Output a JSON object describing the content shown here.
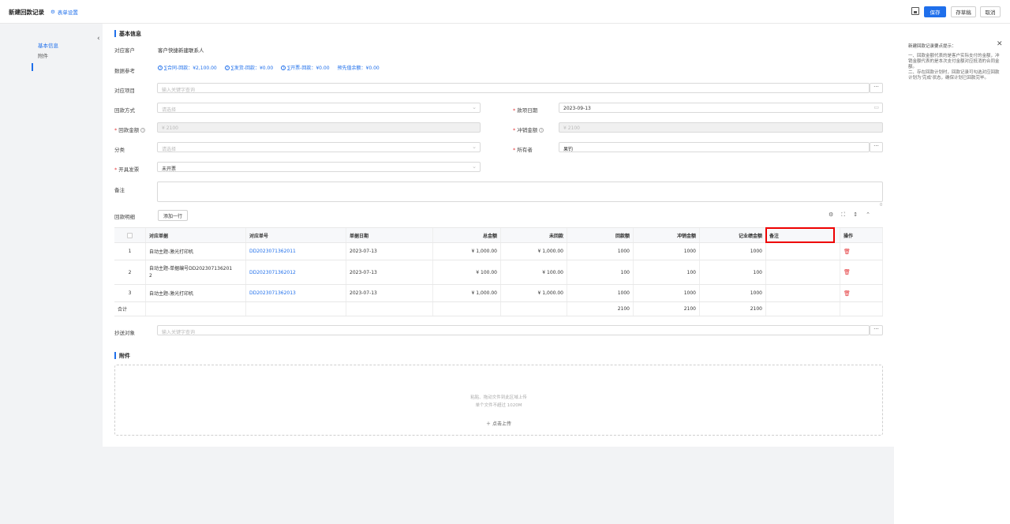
{
  "header": {
    "title": "新建回款记录",
    "form_settings": "表单设置",
    "save": "保存",
    "save_draft": "存草稿",
    "cancel": "取消"
  },
  "nav": {
    "items": [
      "基本信息",
      "附件"
    ]
  },
  "tips": {
    "title": "新建回款记录要点提示：",
    "body": "一、回款金额代表的是客户实际支付的金额，冲销金额代表的是本次支付金额对应抵消的合同金额。\n二、存在回款计划时，回款记录可勾选对应回款计划为'完成'状态，确保计划已回款完毕。"
  },
  "basic": {
    "section_title": "基本信息",
    "customer_label": "对应客户",
    "customer_value": "客户快捷新建联系人",
    "ref_label": "数据参考",
    "refs": [
      "∑合同-回款：¥2,100.00",
      "∑发货-回款：¥0.00",
      "∑开票-回款：¥0.00",
      "预先值余额：¥0.00"
    ],
    "project_label": "对应项目",
    "project_placeholder": "输入关键字查询",
    "method_label": "回款方式",
    "method_placeholder": "请选择",
    "date_label": "款项日期",
    "date_value": "2023-09-13",
    "amount_label": "回款金额",
    "amount_value": "¥ 2100",
    "offset_label": "冲销金额",
    "offset_value": "¥ 2100",
    "category_label": "分类",
    "category_placeholder": "请选择",
    "owner_label": "所有者",
    "owner_value": "果钓",
    "invoice_label": "开具发票",
    "invoice_value": "未开票",
    "remark_label": "备注",
    "remark_count": "0"
  },
  "detail": {
    "label": "回款明细",
    "add_row": "添加一行",
    "columns": [
      "对应单据",
      "对应单号",
      "单据日期",
      "总金额",
      "未回款",
      "回款额",
      "冲销金额",
      "记业绩金额",
      "备注",
      "操作"
    ],
    "rows": [
      {
        "no": "1",
        "doc": "自动主题-激光打印机",
        "code": "DD2023071362011",
        "date": "2023-07-13",
        "total": "¥ 1,000.00",
        "unpaid": "¥ 1,000.00",
        "paid": "1000",
        "offset": "1000",
        "perf": "1000"
      },
      {
        "no": "2",
        "doc": "自动主题-单据编号DD202307136201\n2",
        "code": "DD2023071362012",
        "date": "2023-07-13",
        "total": "¥ 100.00",
        "unpaid": "¥ 100.00",
        "paid": "100",
        "offset": "100",
        "perf": "100"
      },
      {
        "no": "3",
        "doc": "自动主题-激光打印机",
        "code": "DD2023071362013",
        "date": "2023-07-13",
        "total": "¥ 1,000.00",
        "unpaid": "¥ 1,000.00",
        "paid": "1000",
        "offset": "1000",
        "perf": "1000"
      }
    ],
    "total_label": "合计",
    "total_paid": "2100",
    "total_offset": "2100",
    "total_perf": "2100"
  },
  "cc": {
    "label": "抄送对象",
    "placeholder": "输入关键字查询"
  },
  "attachment": {
    "section_title": "附件",
    "hint1": "粘贴、拖动文件到此区域上传",
    "hint2": "单个文件不超过 1020M",
    "upload": "点击上传"
  }
}
